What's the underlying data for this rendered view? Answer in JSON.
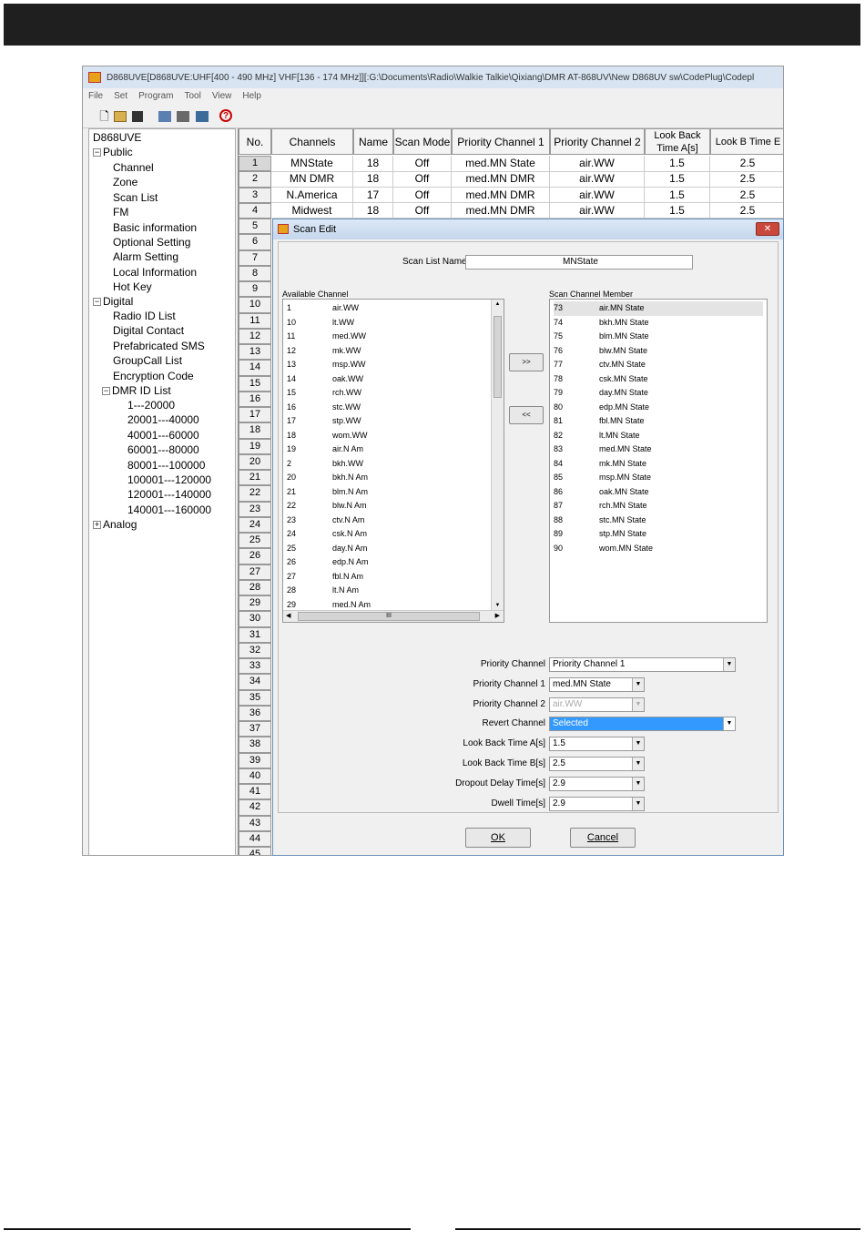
{
  "window": {
    "title": "D868UVE[D868UVE:UHF[400 - 490 MHz] VHF[136 - 174 MHz]][:G:\\Documents\\Radio\\Walkie Talkie\\Qixiang\\DMR AT-868UV\\New D868UV sw\\CodePlug\\Codepl"
  },
  "menu": [
    "File",
    "Set",
    "Program",
    "Tool",
    "View",
    "Help"
  ],
  "tree": {
    "root": "D868UVE",
    "public": "Public",
    "public_items": [
      "Channel",
      "Zone",
      "Scan List",
      "FM",
      "Basic information",
      "Optional Setting",
      "Alarm Setting",
      "Local Information",
      "Hot Key"
    ],
    "digital": "Digital",
    "digital_items": [
      "Radio ID List",
      "Digital Contact",
      "Prefabricated SMS",
      "GroupCall List",
      "Encryption Code",
      "DMR ID List"
    ],
    "dmr_ranges": [
      "1---20000",
      "20001---40000",
      "40001---60000",
      "60001---80000",
      "80001---100000",
      "100001---120000",
      "120001---140000",
      "140001---160000"
    ],
    "analog": "Analog",
    "expanded_box": "−",
    "collapsed_box": "+"
  },
  "grid": {
    "headers": [
      "No.",
      "Channels",
      "Name",
      "Scan Mode",
      "Priority Channel 1",
      "Priority Channel 2",
      "Look Back Time A[s]",
      "Look B Time E"
    ],
    "rows": [
      [
        "MNState",
        "18",
        "Off",
        "med.MN State",
        "air.WW",
        "1.5",
        "2.5"
      ],
      [
        "MN DMR",
        "18",
        "Off",
        "med.MN DMR",
        "air.WW",
        "1.5",
        "2.5"
      ],
      [
        "N.America",
        "17",
        "Off",
        "med.MN DMR",
        "air.WW",
        "1.5",
        "2.5"
      ],
      [
        "Midwest",
        "18",
        "Off",
        "med.MN DMR",
        "air.WW",
        "1.5",
        "2.5"
      ]
    ],
    "row_numbers": [
      "1",
      "2",
      "3",
      "4",
      "5",
      "6",
      "7",
      "8",
      "9",
      "10",
      "11",
      "12",
      "13",
      "14",
      "15",
      "16",
      "17",
      "18",
      "19",
      "20",
      "21",
      "22",
      "23",
      "24",
      "25",
      "26",
      "27",
      "28",
      "29",
      "30",
      "31",
      "32",
      "33",
      "34",
      "35",
      "36",
      "37",
      "38",
      "39",
      "40",
      "41",
      "42",
      "43",
      "44",
      "45"
    ]
  },
  "dialog": {
    "title": "Scan Edit",
    "close": "✕",
    "scan_list_name_label": "Scan List Name",
    "scan_list_name_value": "MNState",
    "available_label": "Available Channel",
    "available": [
      [
        "1",
        "air.WW"
      ],
      [
        "10",
        "lt.WW"
      ],
      [
        "11",
        "med.WW"
      ],
      [
        "12",
        "mk.WW"
      ],
      [
        "13",
        "msp.WW"
      ],
      [
        "14",
        "oak.WW"
      ],
      [
        "15",
        "rch.WW"
      ],
      [
        "16",
        "stc.WW"
      ],
      [
        "17",
        "stp.WW"
      ],
      [
        "18",
        "wom.WW"
      ],
      [
        "19",
        "air.N Am"
      ],
      [
        "2",
        "bkh.WW"
      ],
      [
        "20",
        "bkh.N Am"
      ],
      [
        "21",
        "blm.N Am"
      ],
      [
        "22",
        "blw.N Am"
      ],
      [
        "23",
        "ctv.N Am"
      ],
      [
        "24",
        "csk.N Am"
      ],
      [
        "25",
        "day.N Am"
      ],
      [
        "26",
        "edp.N Am"
      ],
      [
        "27",
        "fbl.N Am"
      ],
      [
        "28",
        "lt.N Am"
      ],
      [
        "29",
        "med.N Am"
      ]
    ],
    "member_label": "Scan Channel Member",
    "members": [
      [
        "73",
        "air.MN State"
      ],
      [
        "74",
        "bkh.MN State"
      ],
      [
        "75",
        "blm.MN State"
      ],
      [
        "76",
        "blw.MN State"
      ],
      [
        "77",
        "ctv.MN State"
      ],
      [
        "78",
        "csk.MN State"
      ],
      [
        "79",
        "day.MN State"
      ],
      [
        "80",
        "edp.MN State"
      ],
      [
        "81",
        "fbl.MN State"
      ],
      [
        "82",
        "lt.MN State"
      ],
      [
        "83",
        "med.MN State"
      ],
      [
        "84",
        "mk.MN State"
      ],
      [
        "85",
        "msp.MN State"
      ],
      [
        "86",
        "oak.MN State"
      ],
      [
        "87",
        "rch.MN State"
      ],
      [
        "88",
        "stc.MN State"
      ],
      [
        "89",
        "stp.MN State"
      ],
      [
        "90",
        "wom.MN State"
      ]
    ],
    "add_btn": ">>",
    "remove_btn": "<<",
    "hscroll_mark": "III",
    "fields": [
      {
        "label": "Priority Channel",
        "value": "Priority Channel 1"
      },
      {
        "label": "Priority Channel 1",
        "value": "med.MN State"
      },
      {
        "label": "Priority Channel 2",
        "value": "air.WW"
      },
      {
        "label": "Revert Channel",
        "value": "Selected"
      },
      {
        "label": "Look Back Time A[s]",
        "value": "1.5"
      },
      {
        "label": "Look Back Time B[s]",
        "value": "2.5"
      },
      {
        "label": "Dropout Delay Time[s]",
        "value": "2.9"
      },
      {
        "label": "Dwell Time[s]",
        "value": "2.9"
      }
    ],
    "ok": "OK",
    "cancel": "Cancel"
  },
  "colors": {
    "topbar": "#1f1f1f",
    "selection": "#3399ff",
    "dialog_border": "#6b8fb8",
    "close_button": "#c9483b"
  }
}
